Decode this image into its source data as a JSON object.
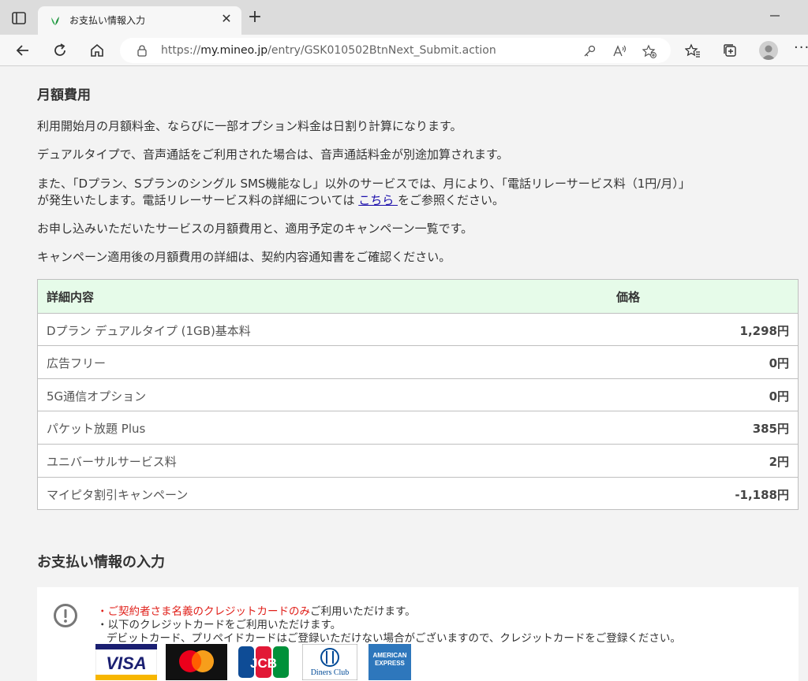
{
  "browser": {
    "tab_title": "お支払い情報入力",
    "url_prefix": "https://",
    "url_host": "my.mineo.jp",
    "url_path": "/entry/GSK010502BtnNext_Submit.action"
  },
  "monthly": {
    "title": "月額費用",
    "p1": "利用開始月の月額料金、ならびに一部オプション料金は日割り計算になります。",
    "p2": "デュアルタイプで、音声通話をご利用された場合は、音声通話料金が別途加算されます。",
    "p3_line1": "また、「Dプラン、Sプランのシングル SMS機能なし」以外のサービスでは、月により、「電話リレーサービス料（1円/月）」",
    "p3_line2_pre": "が発生いたします。電話リレーサービス料の詳細については ",
    "p3_link": "こちら ",
    "p3_line2_post": "をご参照ください。",
    "p4": "お申し込みいただいたサービスの月額費用と、適用予定のキャンペーン一覧です。",
    "p5": "キャンペーン適用後の月額費用の詳細は、契約内容通知書をご確認ください。"
  },
  "table": {
    "header_item": "詳細内容",
    "header_price": "価格",
    "rows": [
      {
        "item": "Dプラン デュアルタイプ (1GB)基本料",
        "price": "1,298円"
      },
      {
        "item": "広告フリー",
        "price": "0円"
      },
      {
        "item": "5G通信オプション",
        "price": "0円"
      },
      {
        "item": "パケット放題 Plus",
        "price": "385円"
      },
      {
        "item": "ユニバーサルサービス料",
        "price": "2円"
      },
      {
        "item": "マイピタ割引キャンペーン",
        "price": "-1,188円"
      }
    ]
  },
  "payment": {
    "title": "お支払い情報の入力",
    "bullet": "・",
    "line1_red": "ご契約者さま名義のクレジットカードのみ",
    "line1_rest": "ご利用いただけます。",
    "line2": "・以下のクレジットカードをご利用いただけます。",
    "line3": "デビットカード、プリペイドカードはご登録いただけない場合がございますので、クレジットカードをご登録ください。",
    "cards": {
      "visa": "VISA",
      "jcb": "JCB",
      "diners": "Diners Club",
      "amex": "AMERICAN EXPRESS"
    }
  },
  "colors": {
    "table_header_bg": "#e6fbe9",
    "warning_red": "#e0201a",
    "link": "#1a0dab"
  }
}
